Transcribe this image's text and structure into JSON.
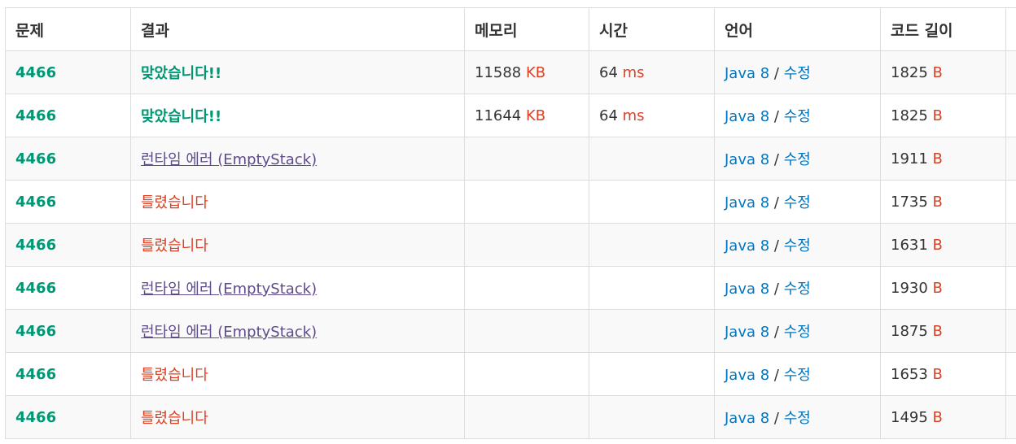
{
  "headers": [
    "문제",
    "결과",
    "메모리",
    "시간",
    "언어",
    "코드 길이"
  ],
  "units": {
    "memory": "KB",
    "time": "ms",
    "length": "B"
  },
  "edit_label": "수정",
  "rows": [
    {
      "problem": "4466",
      "result": "맞았습니다!!",
      "status": "ok",
      "memory": "11588",
      "time": "64",
      "language": "Java 8",
      "length": "1825"
    },
    {
      "problem": "4466",
      "result": "맞았습니다!!",
      "status": "ok",
      "memory": "11644",
      "time": "64",
      "language": "Java 8",
      "length": "1825"
    },
    {
      "problem": "4466",
      "result": "런타임 에러 (EmptyStack)",
      "status": "rte",
      "memory": "",
      "time": "",
      "language": "Java 8",
      "length": "1911"
    },
    {
      "problem": "4466",
      "result": "틀렸습니다",
      "status": "wa",
      "memory": "",
      "time": "",
      "language": "Java 8",
      "length": "1735"
    },
    {
      "problem": "4466",
      "result": "틀렸습니다",
      "status": "wa",
      "memory": "",
      "time": "",
      "language": "Java 8",
      "length": "1631"
    },
    {
      "problem": "4466",
      "result": "런타임 에러 (EmptyStack)",
      "status": "rte",
      "memory": "",
      "time": "",
      "language": "Java 8",
      "length": "1930"
    },
    {
      "problem": "4466",
      "result": "런타임 에러 (EmptyStack)",
      "status": "rte",
      "memory": "",
      "time": "",
      "language": "Java 8",
      "length": "1875"
    },
    {
      "problem": "4466",
      "result": "틀렸습니다",
      "status": "wa",
      "memory": "",
      "time": "",
      "language": "Java 8",
      "length": "1653"
    },
    {
      "problem": "4466",
      "result": "틀렸습니다",
      "status": "wa",
      "memory": "",
      "time": "",
      "language": "Java 8",
      "length": "1495"
    }
  ]
}
